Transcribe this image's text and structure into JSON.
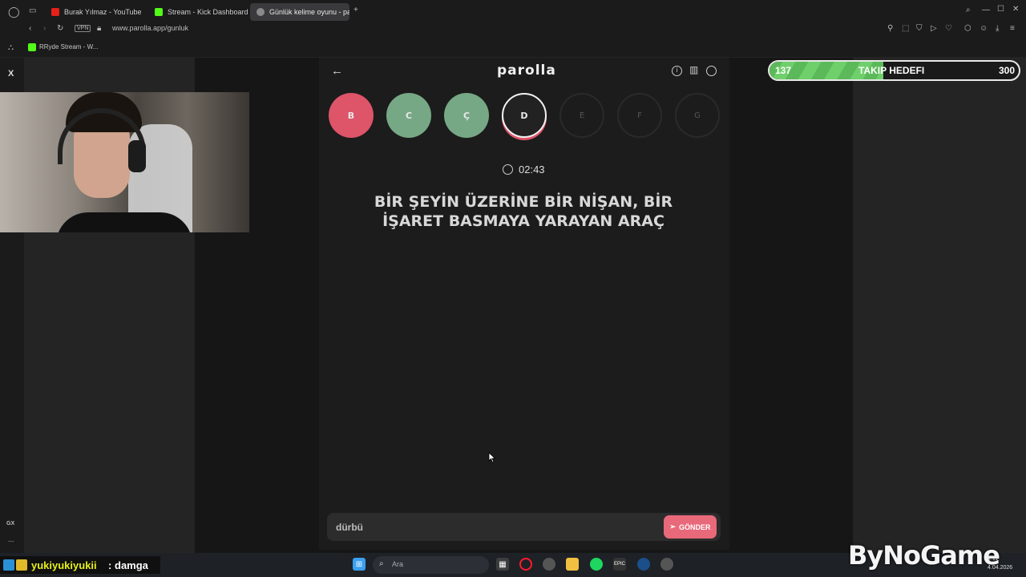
{
  "browser": {
    "tabs": [
      {
        "title": "Burak Yılmaz - YouTube",
        "color": "#e62117"
      },
      {
        "title": "Stream - Kick Dashboard",
        "color": "#53fc18"
      },
      {
        "title": "Günlük kelime oyunu - pa",
        "color": "#8a8a8a"
      }
    ],
    "url": "www.parolla.app/gunluk",
    "vpn_label": "VPN",
    "bookmark": "RRyde Stream - W..."
  },
  "sidebar": {
    "x_label": "X",
    "gx_label": "GX",
    "more_label": "..."
  },
  "game": {
    "logo": "parolla",
    "letters": [
      {
        "letter": "B",
        "state": "wrong",
        "color": "#de5469"
      },
      {
        "letter": "C",
        "state": "correct",
        "color": "#77a885"
      },
      {
        "letter": "Ç",
        "state": "correct",
        "color": "#77a885"
      },
      {
        "letter": "D",
        "state": "current",
        "color": "#222222"
      },
      {
        "letter": "E",
        "state": "pending",
        "color": "#1c1c1c"
      },
      {
        "letter": "F",
        "state": "pending",
        "color": "#1c1c1c"
      },
      {
        "letter": "G",
        "state": "pending",
        "color": "#1c1c1c"
      }
    ],
    "timer": "02:43",
    "question_line1": "BİR ŞEYİN ÜZERİNE BİR NİŞAN, BİR",
    "question_line2": "İŞARET BASMAYA YARAYAN ARAÇ",
    "answer_value": "dürbü",
    "send_label": "GÖNDER"
  },
  "follower_goal": {
    "current": "137",
    "label": "TAKIP HEDEFI",
    "target": "300",
    "progress": 0.457
  },
  "chat": {
    "user": "yukiyukiyukii",
    "separator": ":",
    "message": "damga"
  },
  "taskbar": {
    "search_placeholder": "Ara",
    "time": "1:11",
    "date": "4.04.2026"
  },
  "watermark": "ByNoGame"
}
